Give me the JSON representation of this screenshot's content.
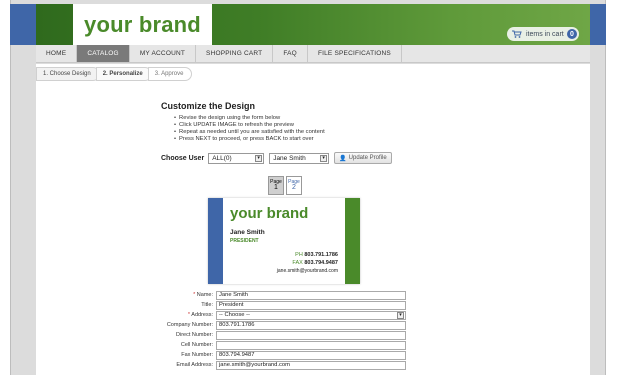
{
  "brand": {
    "name": "your brand"
  },
  "cart": {
    "label": "items in cart",
    "count": "0"
  },
  "nav": [
    {
      "label": "HOME"
    },
    {
      "label": "CATALOG"
    },
    {
      "label": "MY ACCOUNT"
    },
    {
      "label": "SHOPPING CART"
    },
    {
      "label": "FAQ"
    },
    {
      "label": "FILE SPECIFICATIONS"
    }
  ],
  "steps": [
    {
      "label": "1. Choose Design"
    },
    {
      "label": "2. Personalize"
    },
    {
      "label": "3. Approve"
    }
  ],
  "customize": {
    "title": "Customize the Design",
    "instructions": [
      "Revise the design using the form below",
      "Click UPDATE IMAGE to refresh the preview",
      "Repeat as needed until you are satisfied with the content",
      "Press NEXT to proceed, or press BACK to start over"
    ]
  },
  "choose_user": {
    "label": "Choose User",
    "filter_value": "ALL(0)",
    "user_value": "Jane Smith",
    "update_button": "Update Profile"
  },
  "pages": [
    {
      "label": "Page",
      "num": "1"
    },
    {
      "label": "Page",
      "num": "2"
    }
  ],
  "card": {
    "brand": "your brand",
    "name": "Jane Smith",
    "title": "PRESIDENT",
    "ph_label": "PH",
    "ph_value": "803.791.1786",
    "fax_label": "FAX",
    "fax_value": "803.794.9487",
    "email": "jane.smith@yourbrand.com"
  },
  "form": {
    "name_label": "Name:",
    "name_value": "Jane Smith",
    "title_label": "Title:",
    "title_value": "President",
    "address_label": "Address:",
    "address_value": "-- Choose --",
    "company_label": "Company Number:",
    "company_value": "803.791.1786",
    "direct_label": "Direct Number:",
    "direct_value": "",
    "cell_label": "Cell Number:",
    "cell_value": "",
    "fax_label": "Fax Number:",
    "fax_value": "803.794.9487",
    "email_label": "Email Address:",
    "email_value": "jane.smith@yourbrand.com"
  }
}
